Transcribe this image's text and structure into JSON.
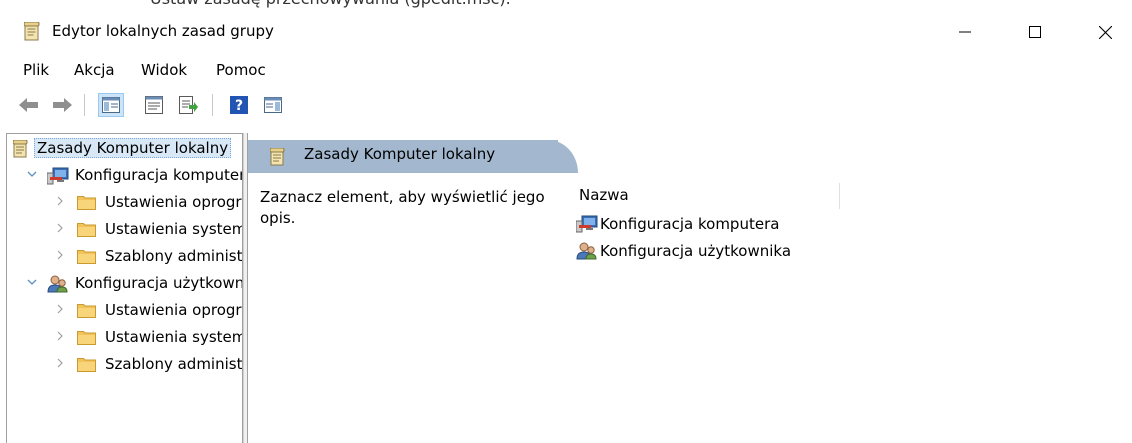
{
  "window": {
    "title": "Edytor lokalnych zasad grupy",
    "caption_strip": "Ustaw zasadę przechowywania (gpedit.msc).",
    "controls": {
      "minimize": "—",
      "maximize": "☐",
      "close": "✕"
    }
  },
  "menu": [
    "Plik",
    "Akcja",
    "Widok",
    "Pomoc"
  ],
  "toolbar": {
    "buttons": [
      "back-arrow-icon",
      "forward-arrow-icon",
      "show-tree-icon",
      "properties-icon",
      "export-list-icon",
      "help-icon",
      "action-pane-icon"
    ]
  },
  "tree": {
    "root": "Zasady Komputer lokalny",
    "nodes": [
      {
        "label": "Konfiguracja komputera",
        "level": 1,
        "expanded": true
      },
      {
        "label": "Ustawienia oprogramowania",
        "level": 2
      },
      {
        "label": "Ustawienia systemu Windows",
        "level": 2
      },
      {
        "label": "Szablony administracyjne",
        "level": 2
      },
      {
        "label": "Konfiguracja użytkownika",
        "level": 1,
        "expanded": true
      },
      {
        "label": "Ustawienia oprogramowania",
        "level": 2
      },
      {
        "label": "Ustawienia systemu Windows",
        "level": 2
      },
      {
        "label": "Szablony administracyjne",
        "level": 2
      }
    ]
  },
  "detail": {
    "title": "Zasady Komputer lokalny",
    "description": "Zaznacz element, aby wyświetlić jego opis.",
    "column_header": "Nazwa",
    "items": [
      "Konfiguracja komputera",
      "Konfiguracja użytkownika"
    ]
  },
  "colors": {
    "header_bar": "#a3b8cf",
    "selection": "#d9e8f7",
    "folder": "#f2c35b"
  }
}
